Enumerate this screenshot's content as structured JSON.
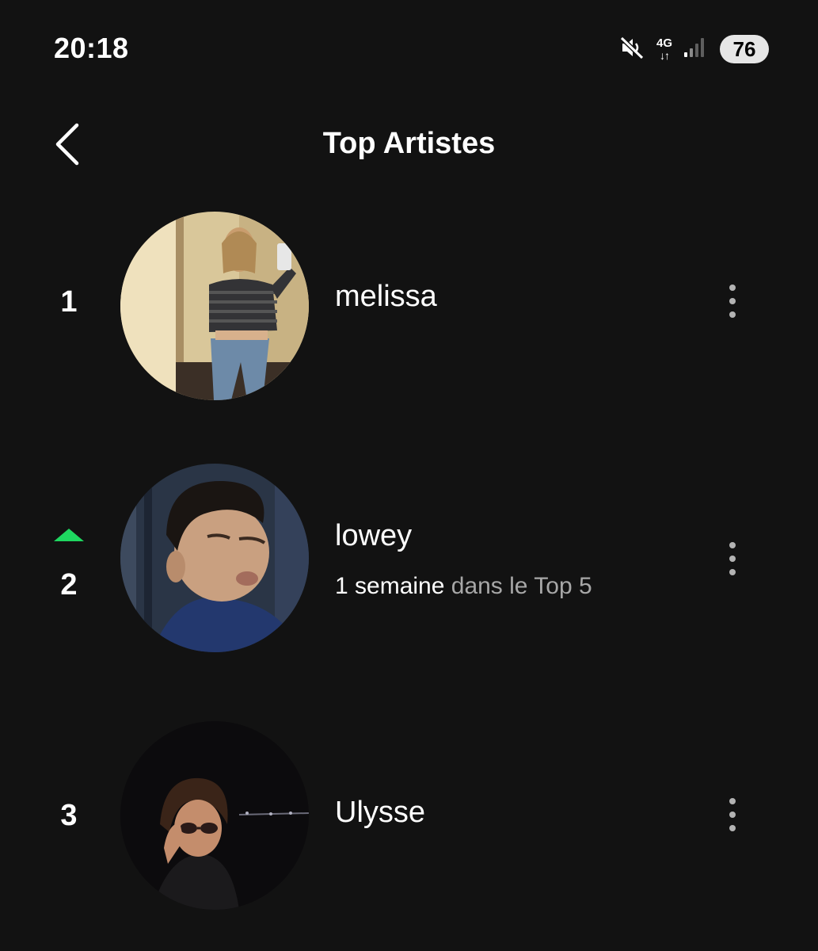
{
  "status_bar": {
    "time": "20:18",
    "network_type": "4G",
    "network_arrows": "↓↑",
    "battery_level": "76",
    "icons": [
      "mute-icon",
      "network-4g-icon",
      "signal-bars-icon",
      "battery-icon"
    ]
  },
  "header": {
    "title": "Top Artistes",
    "back_icon": "chevron-left-icon"
  },
  "artists": [
    {
      "rank": "1",
      "name": "melissa",
      "trend": null,
      "sub_highlight": "",
      "sub_muted": ""
    },
    {
      "rank": "2",
      "name": "lowey",
      "trend": "up",
      "sub_highlight": "1 semaine",
      "sub_muted": " dans le Top 5"
    },
    {
      "rank": "3",
      "name": "Ulysse",
      "trend": null,
      "sub_highlight": "",
      "sub_muted": ""
    }
  ],
  "colors": {
    "background": "#121212",
    "trend_up": "#1ed760",
    "muted_text": "#a7a7a7",
    "more_dots": "#b3b3b3"
  }
}
